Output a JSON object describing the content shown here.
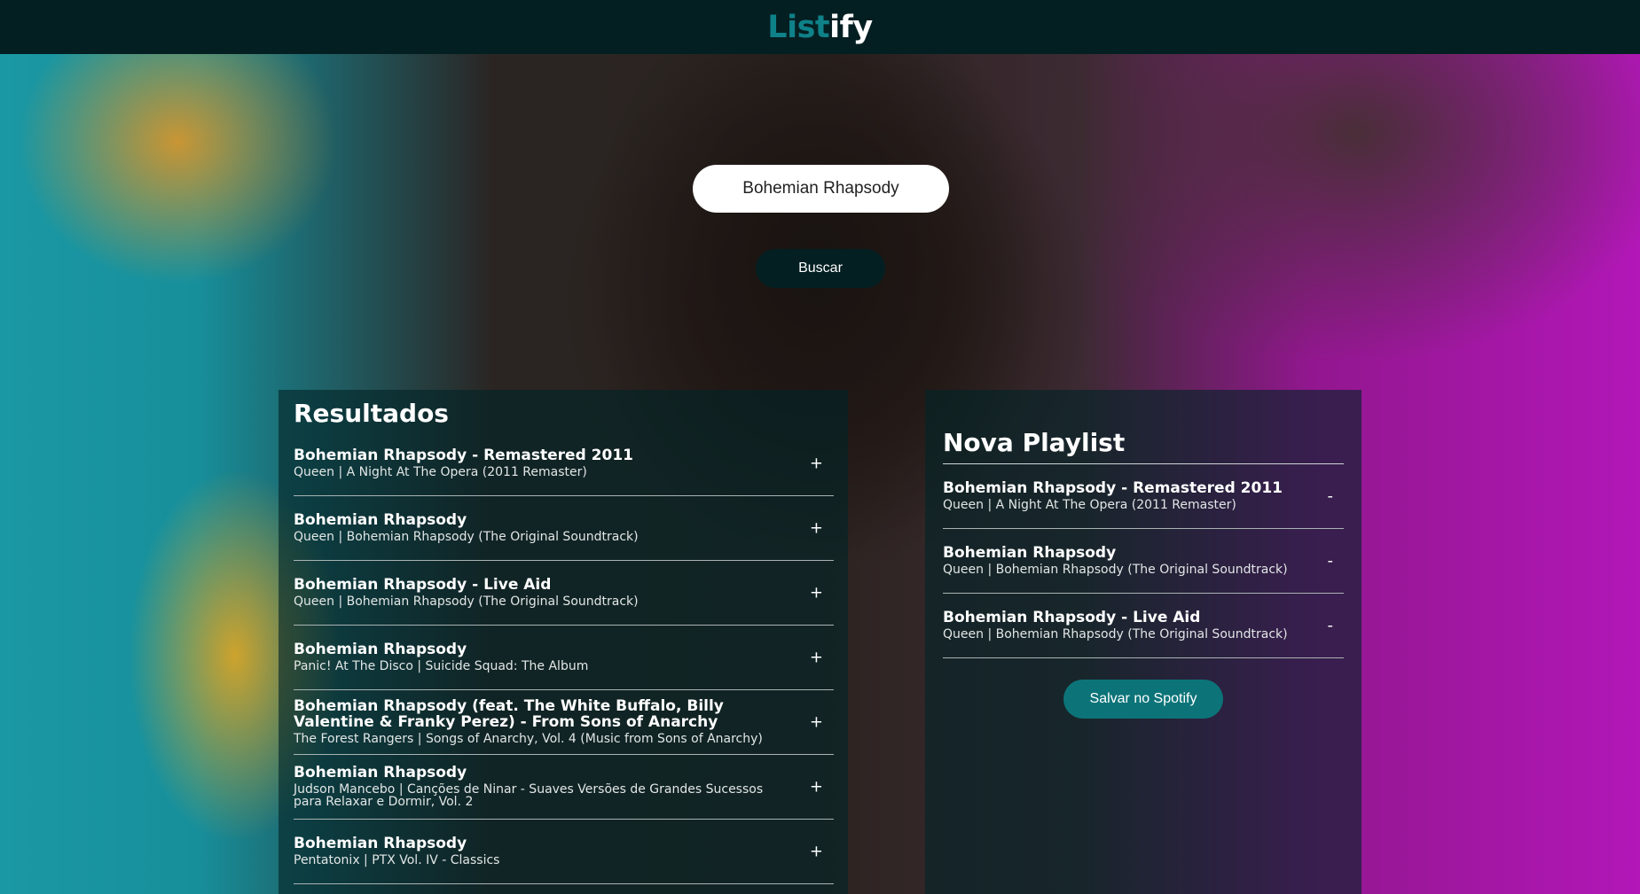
{
  "header": {
    "logo_part1": "List",
    "logo_part2": "ify"
  },
  "search": {
    "value": "Bohemian Rhapsody",
    "button_label": "Buscar"
  },
  "results": {
    "title": "Resultados",
    "action_symbol": "+",
    "tracks": [
      {
        "name": "Bohemian Rhapsody - Remastered 2011",
        "info": "Queen | A Night At The Opera (2011 Remaster)"
      },
      {
        "name": "Bohemian Rhapsody",
        "info": "Queen | Bohemian Rhapsody (The Original Soundtrack)"
      },
      {
        "name": "Bohemian Rhapsody - Live Aid",
        "info": "Queen | Bohemian Rhapsody (The Original Soundtrack)"
      },
      {
        "name": "Bohemian Rhapsody",
        "info": "Panic! At The Disco | Suicide Squad: The Album"
      },
      {
        "name": "Bohemian Rhapsody (feat. The White Buffalo, Billy Valentine & Franky Perez) - From Sons of Anarchy",
        "info": "The Forest Rangers | Songs of Anarchy, Vol. 4 (Music from Sons of Anarchy)"
      },
      {
        "name": "Bohemian Rhapsody",
        "info": "Judson Mancebo | Canções de Ninar - Suaves Versões de Grandes Sucessos para Relaxar e Dormir, Vol. 2"
      },
      {
        "name": "Bohemian Rhapsody",
        "info": "Pentatonix | PTX Vol. IV - Classics"
      }
    ]
  },
  "playlist": {
    "title": "Nova Playlist",
    "action_symbol": "-",
    "save_label": "Salvar no Spotify",
    "tracks": [
      {
        "name": "Bohemian Rhapsody - Remastered 2011",
        "info": "Queen | A Night At The Opera (2011 Remaster)"
      },
      {
        "name": "Bohemian Rhapsody",
        "info": "Queen | Bohemian Rhapsody (The Original Soundtrack)"
      },
      {
        "name": "Bohemian Rhapsody - Live Aid",
        "info": "Queen | Bohemian Rhapsody (The Original Soundtrack)"
      }
    ]
  },
  "colors": {
    "header_bg": "#041f22",
    "logo_accent": "#0f8189",
    "save_button": "#0c7479"
  }
}
